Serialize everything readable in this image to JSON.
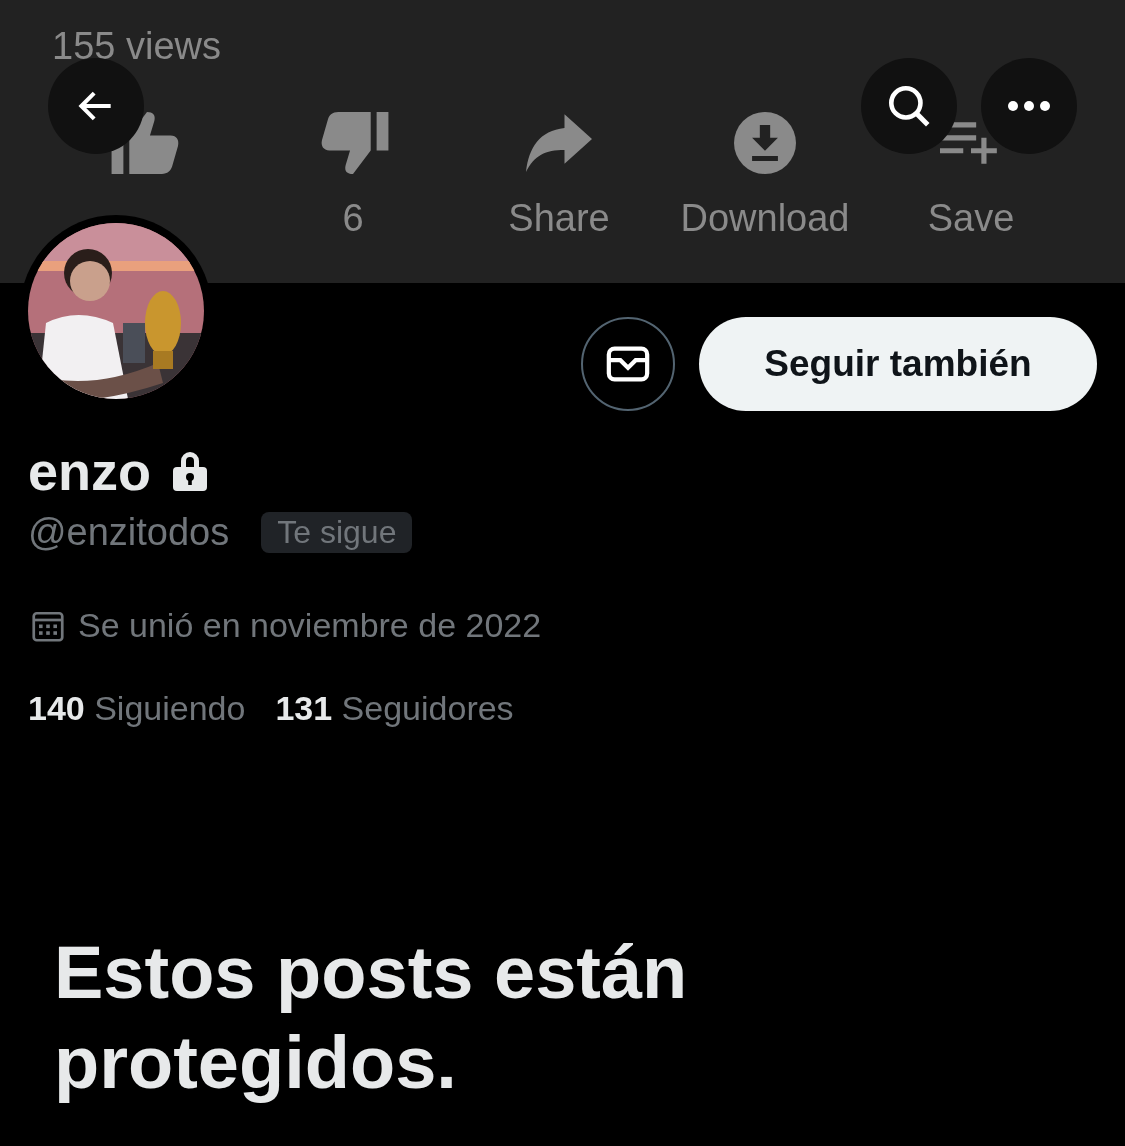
{
  "banner": {
    "kind": "screenshot",
    "views": "155 views",
    "actions": [
      {
        "label": "6"
      },
      {
        "label": "Share"
      },
      {
        "label": "Download"
      },
      {
        "label": "Save"
      }
    ]
  },
  "follow_button": "Seguir también",
  "profile": {
    "name": "enzo",
    "protected": true,
    "handle": "@enzitodos",
    "follows_you": "Te sigue",
    "joined": "Se unió en noviembre de 2022",
    "stats": [
      {
        "count": "140",
        "label": "Siguiendo"
      },
      {
        "count": "131",
        "label": "Seguidores"
      }
    ]
  },
  "protected_message": "Estos posts están protegidos."
}
